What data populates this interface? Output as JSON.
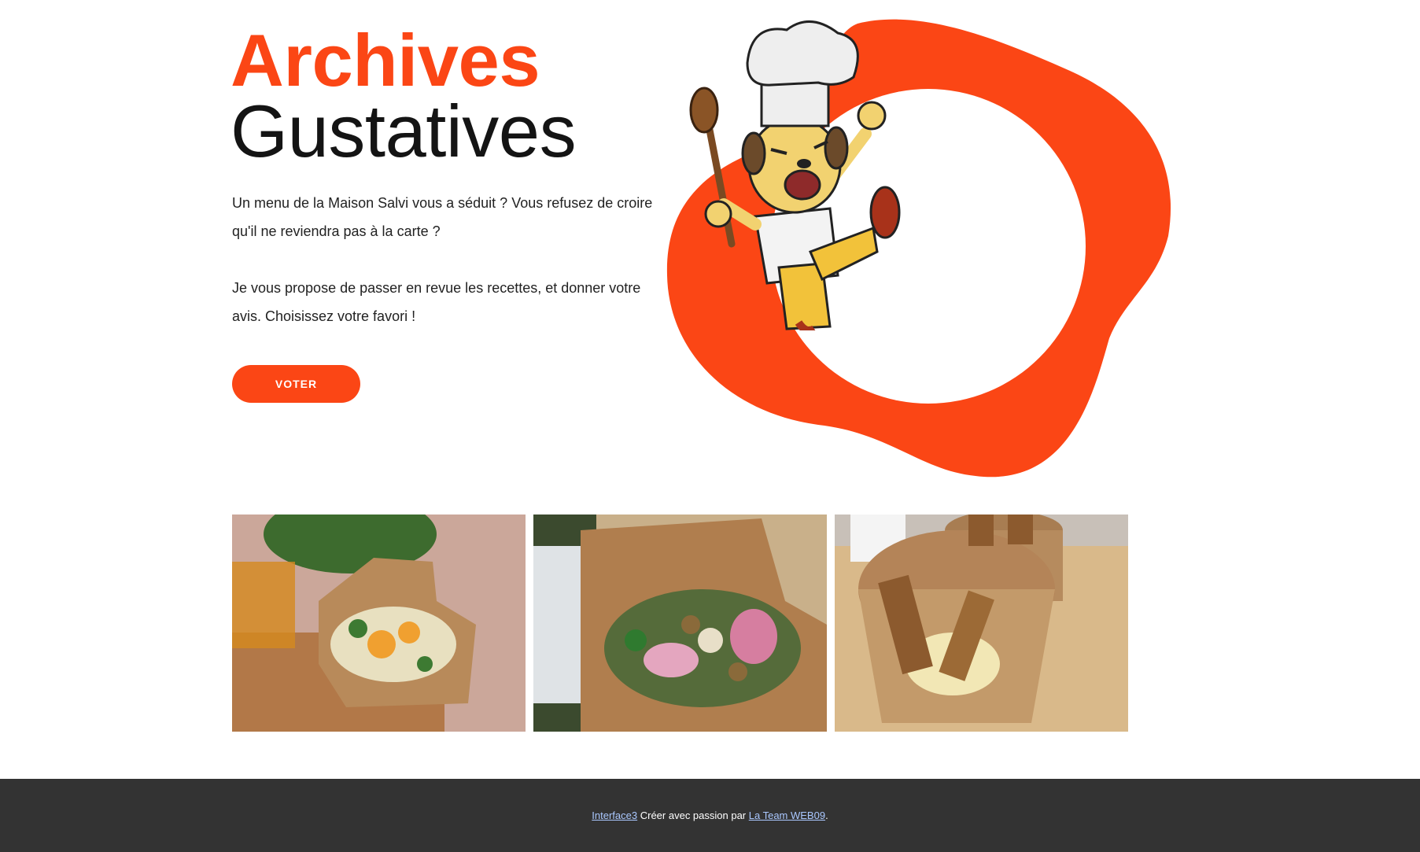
{
  "hero": {
    "title_accent": "Archives",
    "title_main": "Gustatives",
    "paragraph_1": "Un menu de la Maison Salvi vous a séduit ? Vous refusez de croire qu'il ne reviendra pas à la carte ?",
    "paragraph_2": "Je vous propose de passer en revue les recettes, et donner votre avis. Choisissez votre favori !",
    "vote_button_label": "VOTER",
    "mascot_icon": "chef-dog-mascot-icon"
  },
  "gallery": {
    "photos": [
      {
        "icon": "salad-box-photo"
      },
      {
        "icon": "salad-radish-box-photo"
      },
      {
        "icon": "dessert-cups-photo"
      }
    ]
  },
  "footer": {
    "link_1": "Interface3",
    "text_middle": " Créer avec passion par ",
    "link_2": "La Team WEB09",
    "text_end": "."
  },
  "colors": {
    "accent": "#fb4615",
    "footer_bg": "#333333",
    "link": "#aac8ff"
  }
}
